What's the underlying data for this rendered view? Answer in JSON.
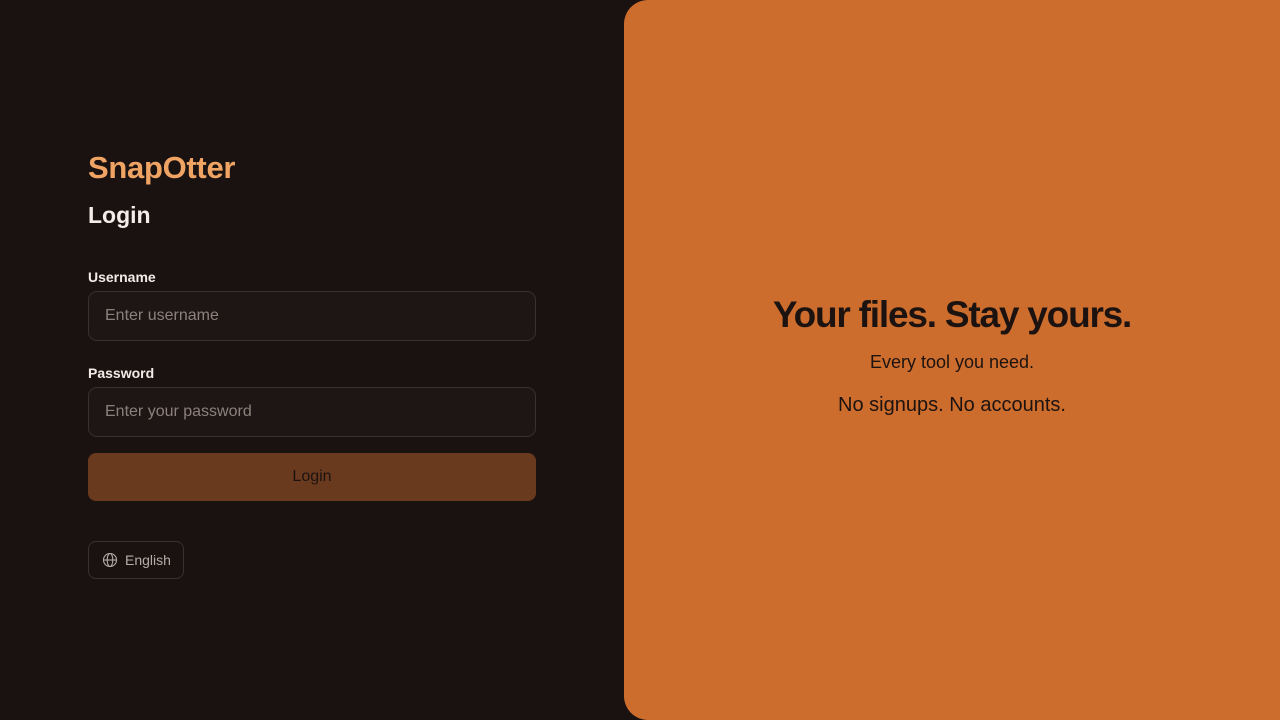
{
  "brand": {
    "name": "SnapOtter",
    "color": "#f0a464"
  },
  "login": {
    "title": "Login",
    "username": {
      "label": "Username",
      "placeholder": "Enter username",
      "value": ""
    },
    "password": {
      "label": "Password",
      "placeholder": "Enter your password",
      "value": ""
    },
    "submit_label": "Login"
  },
  "language": {
    "label": "English",
    "icon": "globe-icon"
  },
  "hero": {
    "title": "Your files. Stay yours.",
    "line1": "Every tool you need.",
    "line2": "No signups. No accounts.",
    "background": "#cc6d2d"
  },
  "colors": {
    "page_background": "#1a1211",
    "button_background": "#6a3a1e"
  }
}
